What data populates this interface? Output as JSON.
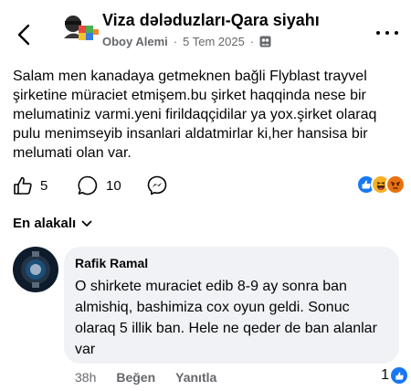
{
  "header": {
    "group_title": "Viza dələduzları-Qara siyahı",
    "author": "Oboy Alemi",
    "date": "5 Tem 2025",
    "separator": "·",
    "back_icon": "chevron-left-icon",
    "more_icon": "more-horizontal-icon",
    "privacy_icon": "members-icon"
  },
  "post": {
    "text": "Salam men kanadaya getmeknen bağli Flyblast trayvel şirketine müraciet etmişem.bu şirket haqqinda nese bir melumatiniz varmi.yeni firildaqçidilar ya yox.şirket olaraq pulu menimseyib insanlari aldatmirlar ki,her hansisa bir melumati olan var."
  },
  "actions": {
    "like_count": "5",
    "comment_count": "10",
    "reactions": [
      "like",
      "haha",
      "angry"
    ]
  },
  "sort_label": "En alakalı",
  "comment": {
    "author": "Rafik Ramal",
    "text": "O shirkete muraciet edib 8-9 ay sonra ban almishiq, bashimiza cox oyun geldi. Sonuc olaraq 5 illik ban. Hele ne qeder de ban alanlar var",
    "time": "38h",
    "like_label": "Beğen",
    "reply_label": "Yanıtla",
    "like_count": "1"
  },
  "colors": {
    "accent": "#1877f2",
    "muted": "#65676b",
    "bubble": "#f0f2f5",
    "angry": "#e9710f",
    "haha": "#f7b125"
  }
}
